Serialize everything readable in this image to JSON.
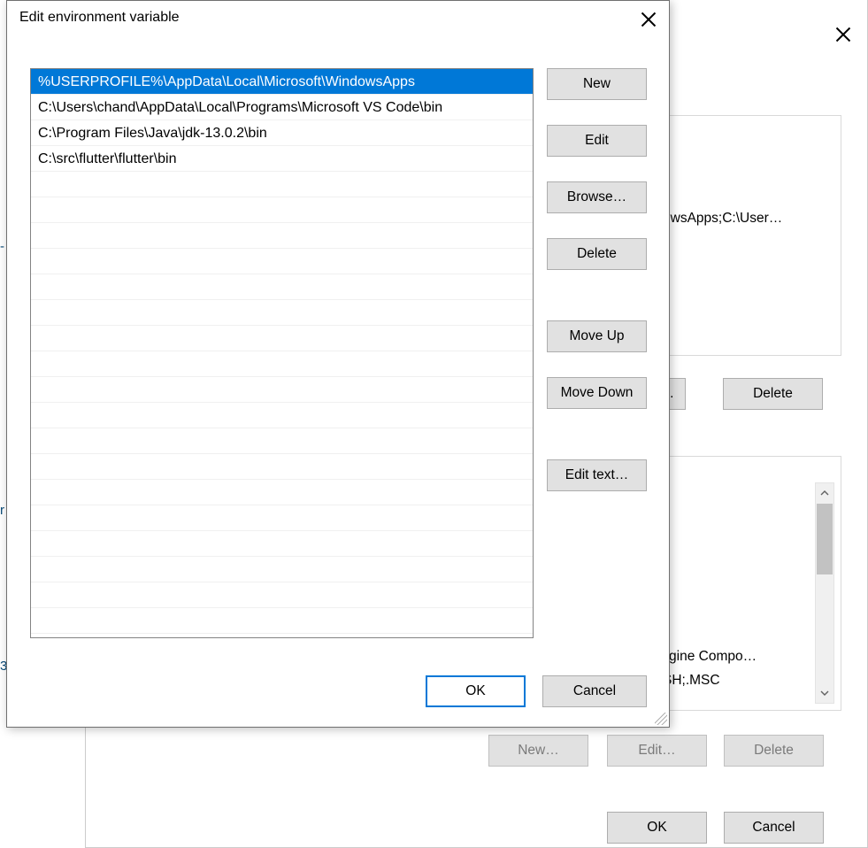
{
  "left_gutter": {
    "hint1": "-",
    "hint2": "r",
    "hint3": "3"
  },
  "bg": {
    "path_fragment": "owsApps;C:\\User…",
    "engine_fragment": "it Engine Compo…",
    "ext_fragment": "SH;.MSC",
    "buttons": {
      "ellipsis": "...",
      "delete_top": "Delete",
      "new_disabled": "New…",
      "edit_disabled": "Edit…",
      "delete_disabled": "Delete",
      "ok": "OK",
      "cancel": "Cancel"
    }
  },
  "fg": {
    "title": "Edit environment variable",
    "entries": [
      "%USERPROFILE%\\AppData\\Local\\Microsoft\\WindowsApps",
      "C:\\Users\\chand\\AppData\\Local\\Programs\\Microsoft VS Code\\bin",
      "C:\\Program Files\\Java\\jdk-13.0.2\\bin",
      "C:\\src\\flutter\\flutter\\bin"
    ],
    "selected_index": 0,
    "buttons": {
      "new_": "New",
      "edit": "Edit",
      "browse": "Browse…",
      "delete": "Delete",
      "move_up": "Move Up",
      "move_down": "Move Down",
      "edit_text": "Edit text…",
      "ok": "OK",
      "cancel": "Cancel"
    }
  }
}
